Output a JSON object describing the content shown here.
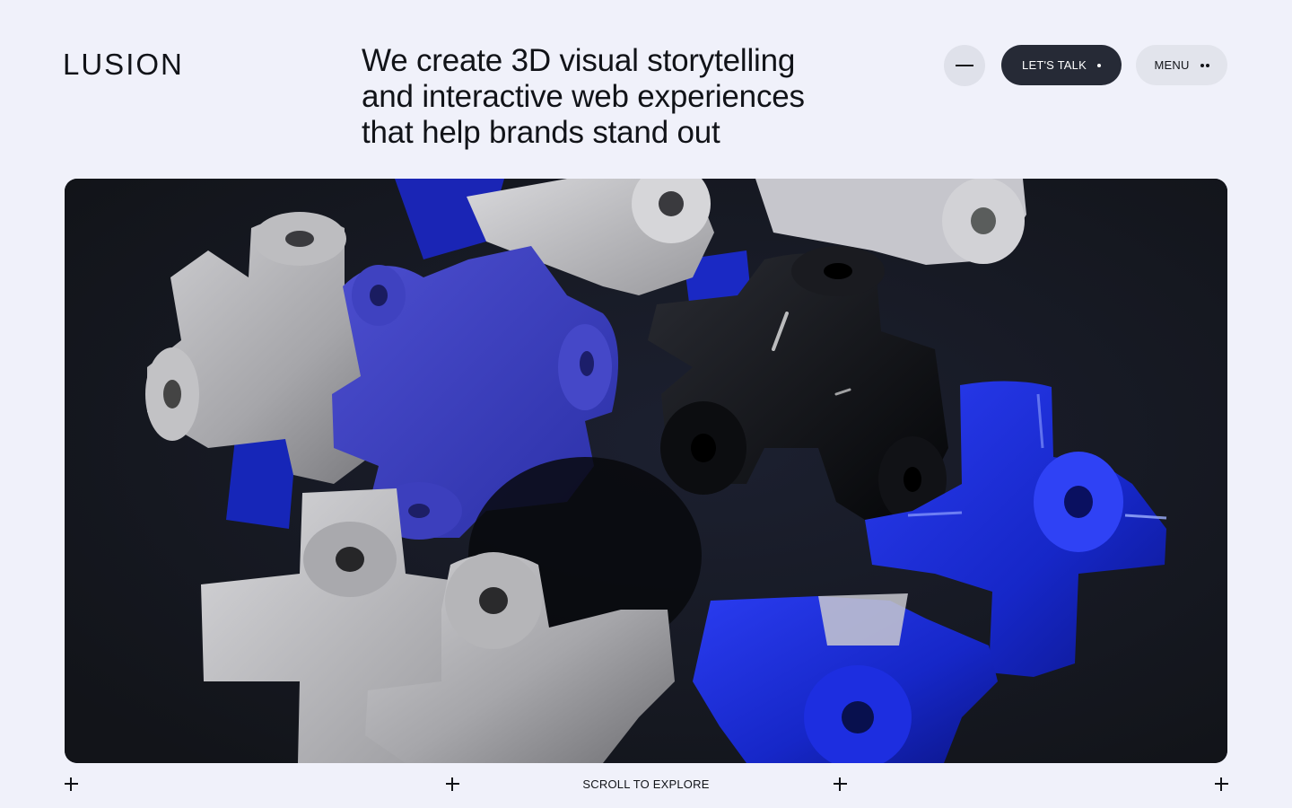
{
  "header": {
    "logo": "LUSION",
    "tagline": [
      "We create 3D visual storytelling",
      "and interactive web experiences",
      "that help brands stand out"
    ],
    "talk_label": "LET'S TALK",
    "menu_label": "MENU"
  },
  "footer": {
    "scroll_label": "SCROLL TO EXPLORE"
  },
  "colors": {
    "background": "#f0f1fa",
    "hero_background": "#14161e",
    "primary_button": "#262a36",
    "blue_shape": "#1f2fd6",
    "grey_shape": "#a8a8ac",
    "black_shape": "#08090c"
  },
  "icons": {
    "minimize": "minus-icon",
    "talk": "dot-icon",
    "menu": "two-dots-icon",
    "markers": "plus-icon"
  }
}
